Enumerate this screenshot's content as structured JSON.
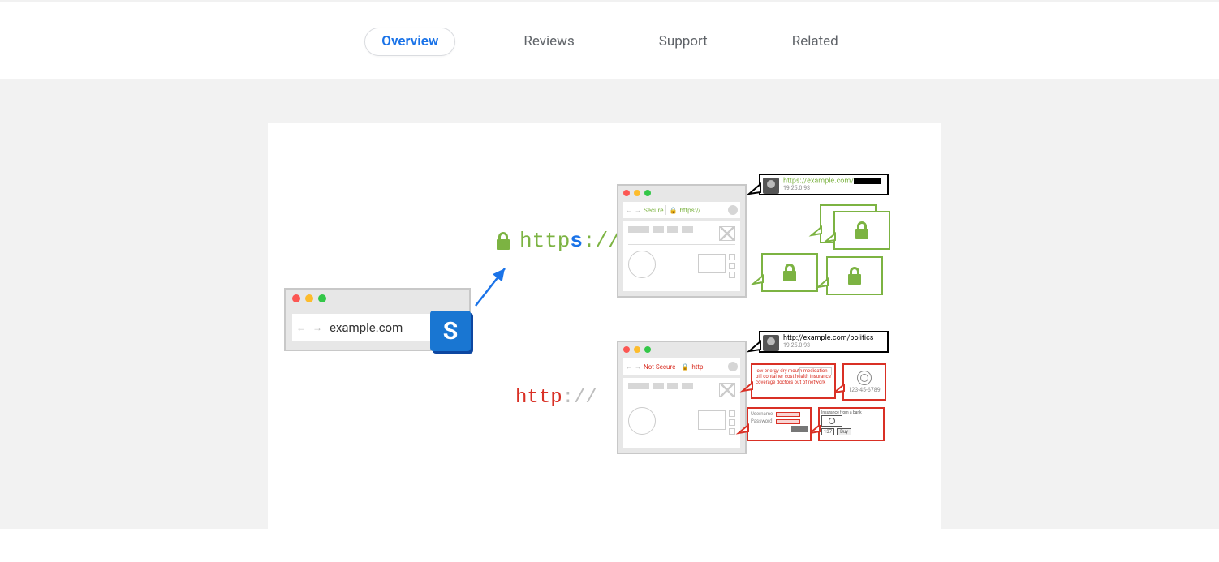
{
  "tabs": {
    "overview": "Overview",
    "reviews": "Reviews",
    "support": "Support",
    "related": "Related"
  },
  "diagram": {
    "source_url": "example.com",
    "s_badge": "S",
    "https_label_prefix": "http",
    "https_label_s": "s",
    "https_label_suffix": "://",
    "http_label_prefix": "http",
    "http_label_suffix": "://",
    "secure_text": "Secure",
    "notsecure_text": "Not Secure",
    "tiny_https": "https://",
    "tiny_http": "http",
    "info_https_url": "https://example.com/",
    "info_https_ip": "19.25.0.93",
    "info_http_url": "http://example.com/politics",
    "info_http_ip": "19.25.0.93",
    "red_lines": "low energy dry mouth\nmedication pill container cost\nhealth insurance coverage\ndoctors out of network",
    "fp_ssn": "123-45-6789",
    "login_user": "Username",
    "login_pass": "Password",
    "cash_title": "Insurance from a bank",
    "cash_num": "137",
    "cash_buy": "Buy"
  }
}
